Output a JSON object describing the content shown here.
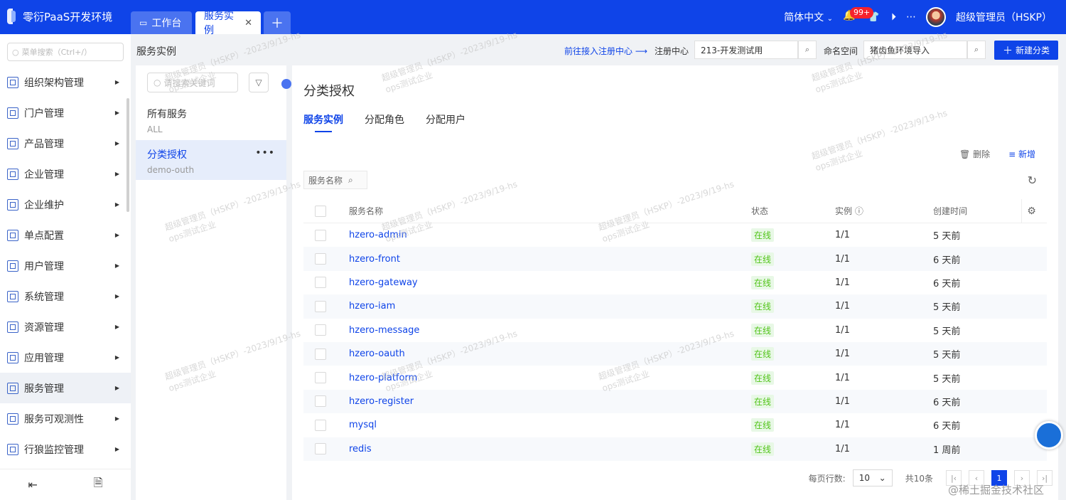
{
  "app": {
    "title": "零衍PaaS开发环境"
  },
  "tabs": [
    {
      "label": "工作台"
    },
    {
      "label": "服务实例"
    }
  ],
  "topbar": {
    "language": "简体中文",
    "notifications": "99+",
    "user": "超级管理员（HSKP）"
  },
  "sidebar": {
    "search_placeholder": "菜单搜索（Ctrl+/）",
    "items": [
      {
        "label": "组织架构管理"
      },
      {
        "label": "门户管理"
      },
      {
        "label": "产品管理"
      },
      {
        "label": "企业管理"
      },
      {
        "label": "企业维护"
      },
      {
        "label": "单点配置"
      },
      {
        "label": "用户管理"
      },
      {
        "label": "系统管理"
      },
      {
        "label": "资源管理"
      },
      {
        "label": "应用管理"
      },
      {
        "label": "服务管理"
      },
      {
        "label": "服务可观测性"
      },
      {
        "label": "行狼监控管理"
      }
    ]
  },
  "breadcrumb": {
    "title": "服务实例",
    "register_link": "前往接入注册中心 ⟶",
    "register_label": "注册中心",
    "register_value": "213-开发测试用",
    "namespace_label": "命名空间",
    "namespace_value": "猪齿鱼环境导入",
    "new_category": "新建分类"
  },
  "left_panel": {
    "search_placeholder": "请搜索关键词",
    "items": [
      {
        "title": "所有服务",
        "sub": "ALL"
      },
      {
        "title": "分类授权",
        "sub": "demo-outh"
      }
    ]
  },
  "main": {
    "title": "分类授权",
    "subtabs": [
      {
        "label": "服务实例"
      },
      {
        "label": "分配角色"
      },
      {
        "label": "分配用户"
      }
    ],
    "delete": "删除",
    "add": "新增",
    "search_label": "服务名称",
    "columns": {
      "name": "服务名称",
      "state": "状态",
      "instance": "实例",
      "created": "创建时间"
    },
    "rows": [
      {
        "name": "hzero-admin",
        "state": "在线",
        "instance": "1/1",
        "created": "5 天前"
      },
      {
        "name": "hzero-front",
        "state": "在线",
        "instance": "1/1",
        "created": "6 天前"
      },
      {
        "name": "hzero-gateway",
        "state": "在线",
        "instance": "1/1",
        "created": "6 天前"
      },
      {
        "name": "hzero-iam",
        "state": "在线",
        "instance": "1/1",
        "created": "5 天前"
      },
      {
        "name": "hzero-message",
        "state": "在线",
        "instance": "1/1",
        "created": "5 天前"
      },
      {
        "name": "hzero-oauth",
        "state": "在线",
        "instance": "1/1",
        "created": "5 天前"
      },
      {
        "name": "hzero-platform",
        "state": "在线",
        "instance": "1/1",
        "created": "5 天前"
      },
      {
        "name": "hzero-register",
        "state": "在线",
        "instance": "1/1",
        "created": "6 天前"
      },
      {
        "name": "mysql",
        "state": "在线",
        "instance": "1/1",
        "created": "6 天前"
      },
      {
        "name": "redis",
        "state": "在线",
        "instance": "1/1",
        "created": "1 周前"
      }
    ],
    "pager": {
      "rows_label": "每页行数:",
      "rows_value": "10",
      "total": "共10条",
      "page": "1"
    }
  },
  "watermark": {
    "line1": "超级管理员（HSKP）-2023/9/19-hs",
    "line2": "ops测试企业"
  },
  "credit": "@稀土掘金技术社区"
}
